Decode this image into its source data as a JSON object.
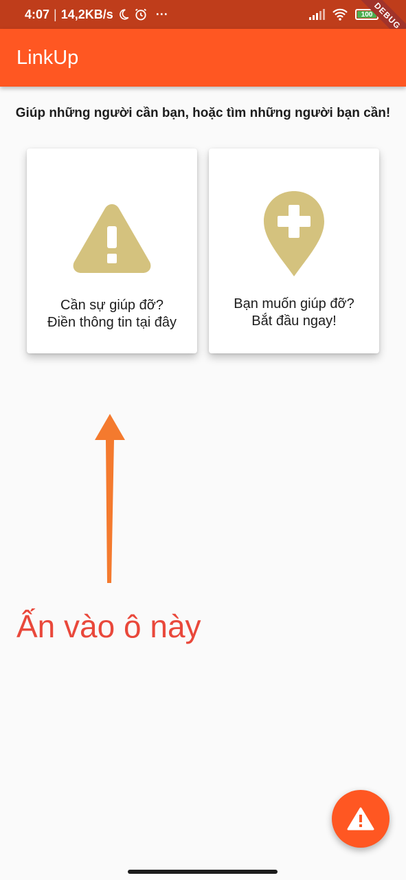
{
  "status_bar": {
    "time": "4:07",
    "separator": "|",
    "speed": "14,2KB/s",
    "more": "···",
    "battery_level": "100",
    "debug_label": "DEBUG"
  },
  "app_bar": {
    "title": "LinkUp"
  },
  "main": {
    "subtitle": "Giúp những người cần bạn, hoặc tìm những người bạn cần!",
    "cards": [
      {
        "line1": "Cần sự giúp đỡ?",
        "line2": "Điền thông tin tại đây",
        "icon": "warning-icon"
      },
      {
        "line1": "Bạn muốn giúp đỡ?",
        "line2": "Bắt đầu ngay!",
        "icon": "location-add-icon"
      }
    ],
    "annotation": "Ấn vào ô này"
  },
  "fab": {
    "icon": "warning-icon"
  },
  "colors": {
    "primary": "#ff5722",
    "status_bar": "#bf3d1b",
    "icon_tint": "#d4c27e",
    "annotation_text": "#e9483b",
    "arrow": "#f47a2e"
  }
}
